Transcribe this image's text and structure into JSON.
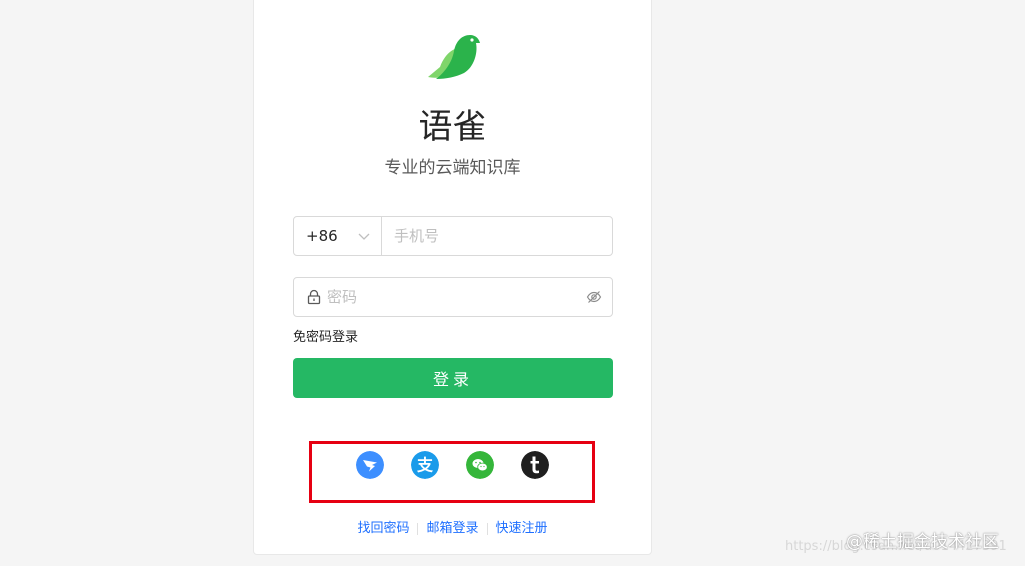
{
  "app": {
    "title": "语雀",
    "subtitle": "专业的云端知识库"
  },
  "form": {
    "country_code": "+86",
    "phone_placeholder": "手机号",
    "password_placeholder": "密码",
    "passwordless_label": "免密码登录",
    "login_label": "登录"
  },
  "oauth": [
    {
      "name": "dingtalk-icon",
      "color": "#3d8fff"
    },
    {
      "name": "alipay-icon",
      "color": "#1a9bea"
    },
    {
      "name": "wechat-icon",
      "color": "#35b63a"
    },
    {
      "name": "taobao-icon",
      "color": "#1f1f1f"
    }
  ],
  "footer": {
    "links": [
      "找回密码",
      "邮箱登录",
      "快速注册"
    ]
  },
  "watermark": {
    "main": "@稀土掘金技术社区",
    "url": "https://blog.csdn.net/u014427391"
  },
  "colors": {
    "accent": "#25b864",
    "link": "#1e6fff",
    "highlight": "#e60012"
  }
}
